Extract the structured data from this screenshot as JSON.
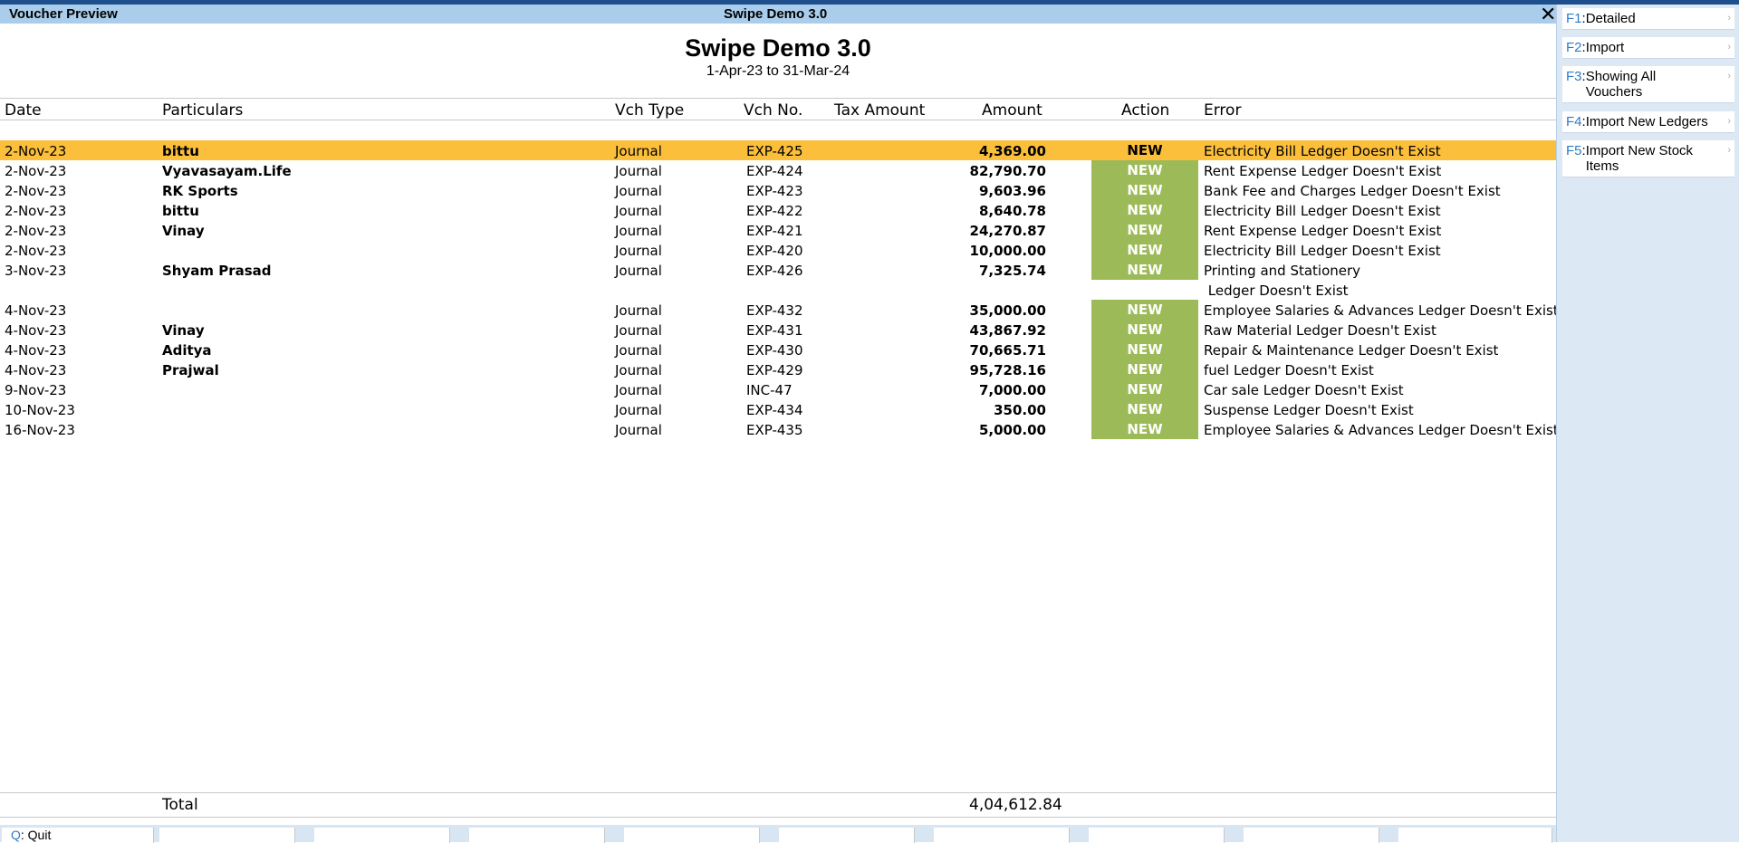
{
  "window": {
    "title_left": "Voucher Preview",
    "title_center": "Swipe Demo 3.0",
    "close_symbol": "✕"
  },
  "report": {
    "company": "Swipe Demo 3.0",
    "period": "1-Apr-23 to 31-Mar-24"
  },
  "columns": {
    "date": "Date",
    "particulars": "Particulars",
    "vch_type": "Vch Type",
    "vch_no": "Vch No.",
    "tax_amount": "Tax Amount",
    "amount": "Amount",
    "action": "Action",
    "error": "Error"
  },
  "rows": [
    {
      "date": "2-Nov-23",
      "particulars": "bittu",
      "vch_type": "Journal",
      "vch_no": "EXP-425",
      "amount": "4,369.00",
      "action": "NEW",
      "error": "Electricity Bill Ledger Doesn't Exist",
      "error2": ""
    },
    {
      "date": "2-Nov-23",
      "particulars": "Vyavasayam.Life",
      "vch_type": "Journal",
      "vch_no": "EXP-424",
      "amount": "82,790.70",
      "action": "NEW",
      "error": "Rent Expense Ledger Doesn't Exist",
      "error2": ""
    },
    {
      "date": "2-Nov-23",
      "particulars": "RK Sports",
      "vch_type": "Journal",
      "vch_no": "EXP-423",
      "amount": "9,603.96",
      "action": "NEW",
      "error": "Bank Fee and Charges Ledger Doesn't Exist",
      "error2": ""
    },
    {
      "date": "2-Nov-23",
      "particulars": "bittu",
      "vch_type": "Journal",
      "vch_no": "EXP-422",
      "amount": "8,640.78",
      "action": "NEW",
      "error": "Electricity Bill Ledger Doesn't Exist",
      "error2": ""
    },
    {
      "date": "2-Nov-23",
      "particulars": "Vinay",
      "vch_type": "Journal",
      "vch_no": "EXP-421",
      "amount": "24,270.87",
      "action": "NEW",
      "error": "Rent Expense Ledger Doesn't Exist",
      "error2": ""
    },
    {
      "date": "2-Nov-23",
      "particulars": "",
      "vch_type": "Journal",
      "vch_no": "EXP-420",
      "amount": "10,000.00",
      "action": "NEW",
      "error": "Electricity Bill Ledger Doesn't Exist",
      "error2": ""
    },
    {
      "date": "3-Nov-23",
      "particulars": "Shyam Prasad",
      "vch_type": "Journal",
      "vch_no": "EXP-426",
      "amount": "7,325.74",
      "action": "NEW",
      "error": "Printing and Stationery",
      "error2": " Ledger Doesn't Exist"
    },
    {
      "date": "4-Nov-23",
      "particulars": "",
      "vch_type": "Journal",
      "vch_no": "EXP-432",
      "amount": "35,000.00",
      "action": "NEW",
      "error": "Employee Salaries & Advances Ledger Doesn't Exist",
      "error2": ""
    },
    {
      "date": "4-Nov-23",
      "particulars": "Vinay",
      "vch_type": "Journal",
      "vch_no": "EXP-431",
      "amount": "43,867.92",
      "action": "NEW",
      "error": "Raw Material Ledger Doesn't Exist",
      "error2": ""
    },
    {
      "date": "4-Nov-23",
      "particulars": "Aditya",
      "vch_type": "Journal",
      "vch_no": "EXP-430",
      "amount": "70,665.71",
      "action": "NEW",
      "error": "Repair & Maintenance Ledger Doesn't Exist",
      "error2": ""
    },
    {
      "date": "4-Nov-23",
      "particulars": "Prajwal",
      "vch_type": "Journal",
      "vch_no": "EXP-429",
      "amount": "95,728.16",
      "action": "NEW",
      "error": "fuel Ledger Doesn't Exist",
      "error2": ""
    },
    {
      "date": "9-Nov-23",
      "particulars": "",
      "vch_type": "Journal",
      "vch_no": "INC-47",
      "amount": "7,000.00",
      "action": "NEW",
      "error": "Car sale Ledger Doesn't Exist",
      "error2": ""
    },
    {
      "date": "10-Nov-23",
      "particulars": "",
      "vch_type": "Journal",
      "vch_no": "EXP-434",
      "amount": "350.00",
      "action": "NEW",
      "error": "Suspense Ledger Doesn't Exist",
      "error2": ""
    },
    {
      "date": "16-Nov-23",
      "particulars": "",
      "vch_type": "Journal",
      "vch_no": "EXP-435",
      "amount": "5,000.00",
      "action": "NEW",
      "error": "Employee Salaries & Advances Ledger Doesn't Exist",
      "error2": ""
    }
  ],
  "selected_row_index": 0,
  "total": {
    "label": "Total",
    "amount": "4,04,612.84"
  },
  "sidebar": [
    {
      "key": "F1",
      "label": "Detailed"
    },
    {
      "key": "F2",
      "label": "Import"
    },
    {
      "key": "F3",
      "label": "Showing All Vouchers"
    },
    {
      "key": "F4",
      "label": "Import New Ledgers"
    },
    {
      "key": "F5",
      "label": "Import New Stock Items"
    }
  ],
  "bottom": {
    "quit_key": "Q",
    "quit_label": "Quit"
  },
  "colors": {
    "selected_row": "#fbbf3c",
    "action_bg": "#9cbb58",
    "titlebar": "#a9cdea",
    "key_accent": "#2f7bc6"
  }
}
